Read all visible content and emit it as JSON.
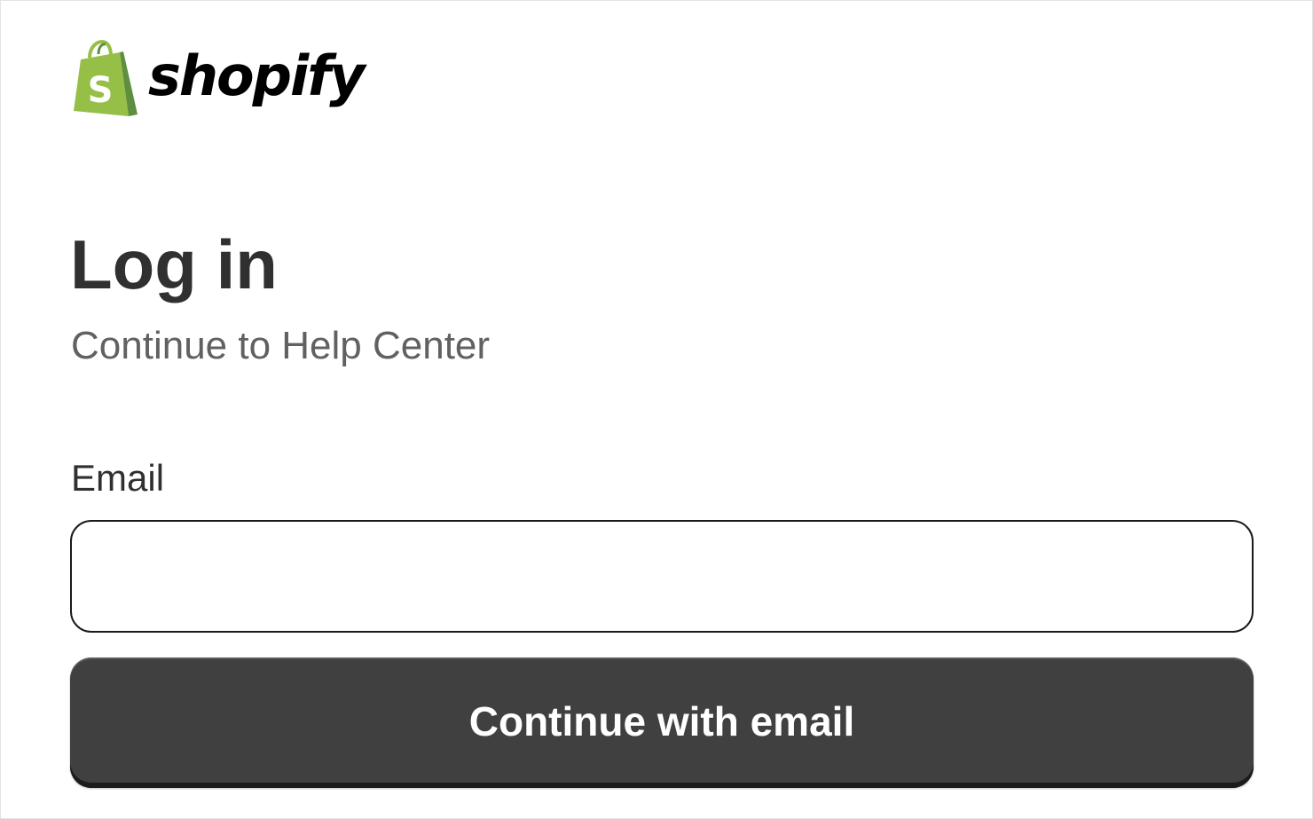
{
  "brand": {
    "name": "shopify",
    "logo_icon": "shopify-bag-icon",
    "bag_color": "#95bf47",
    "bag_shadow_color": "#5e8e3e"
  },
  "login": {
    "title": "Log in",
    "subtitle": "Continue to Help Center",
    "email_label": "Email",
    "email_value": "",
    "email_placeholder": "",
    "submit_label": "Continue with email",
    "button_color": "#404040"
  }
}
